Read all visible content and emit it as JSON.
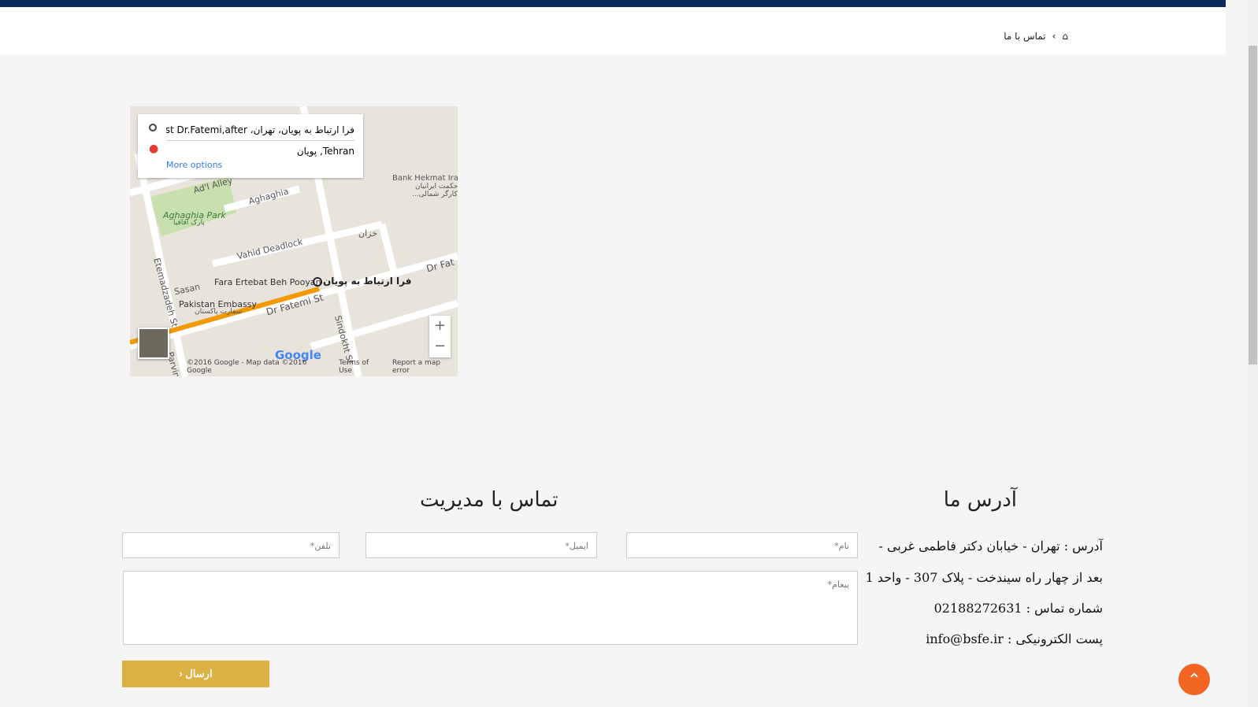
{
  "breadcrumb": {
    "home_icon": "home-icon",
    "separator": "›",
    "current": "تماس با ما"
  },
  "map": {
    "origin": "فرا ارتباط به پویان، تهران، West Dr.Fatemi,after...",
    "destination": "Tehran, پویان",
    "more_options": "More options",
    "labels": {
      "ad": "Ad'l Alley",
      "aghaghia": "Aghaghia",
      "park": "Aghaghia Park",
      "park_fa": "پارک اقاقیا",
      "vahid": "Vahid Deadlock",
      "khazan": "خزان",
      "bank": "Bank Hekmat Iran",
      "bank_fa": "حکمت ایرانیان",
      "bank_fa2": "...کارگر شمالی",
      "fara": "Fara Ertebat Beh Pooyan",
      "fara_fa": "فرا ارتباط به پویان",
      "sasan": "Sasan",
      "embassy": "Pakistan Embassy",
      "embassy_fa": "سفارت پاکستان",
      "fatemi": "Dr Fatemi St",
      "fatemi2": "Dr Fat",
      "etemad": "Etemadzadeh St",
      "sindokht": "Sindokht St",
      "parvin": "Parvin"
    },
    "zoom_in": "+",
    "zoom_out": "−",
    "google": "Google",
    "copyright": "©2016 Google - Map data ©2016 Google",
    "terms": "Terms of Use",
    "report": "Report a map error",
    "route_color": "#f29900"
  },
  "address": {
    "title": "آدرس ما",
    "line1": "آدرس : تهران - خیابان دکتر فاطمی غربی -",
    "line2": "بعد از چهار راه سیندخت - پلاک 307 - واحد 1",
    "phone": "شماره تماس : 02188272631",
    "email": "پست الکترونیکی : info@bsfe.ir"
  },
  "contact": {
    "title": "تماس با مدیریت",
    "name_placeholder": "نام*",
    "email_placeholder": "ایمیل*",
    "phone_placeholder": "تلفن*",
    "message_placeholder": "پیغام*",
    "send_label": "ارسال ‹"
  }
}
